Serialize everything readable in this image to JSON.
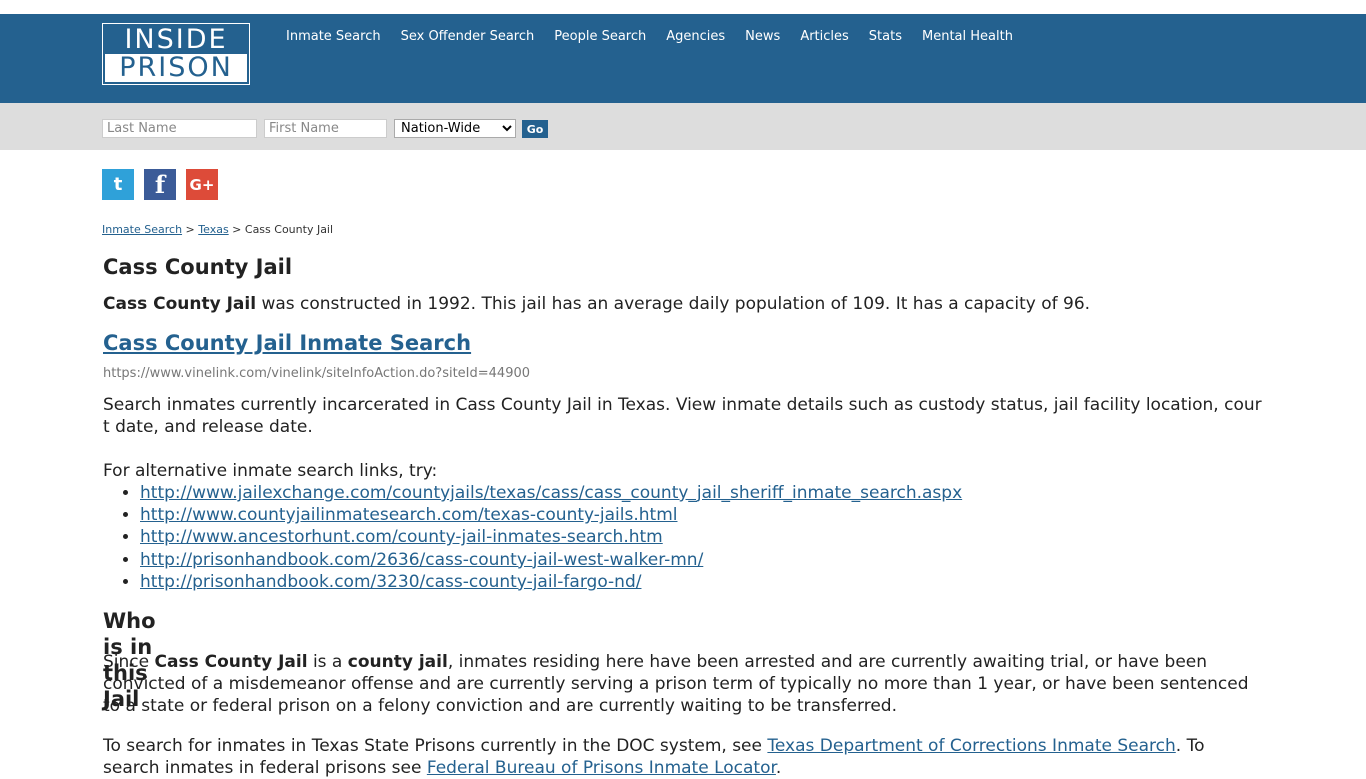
{
  "logo": {
    "line1": "INSIDE",
    "line2": "PRISON"
  },
  "nav": [
    {
      "label": "Inmate Search"
    },
    {
      "label": "Sex Offender Search"
    },
    {
      "label": "People Search"
    },
    {
      "label": "Agencies"
    },
    {
      "label": "News"
    },
    {
      "label": "Articles"
    },
    {
      "label": "Stats"
    },
    {
      "label": "Mental Health"
    }
  ],
  "search": {
    "last_name_placeholder": "Last Name",
    "first_name_placeholder": "First Name",
    "region_selected": "Nation-Wide",
    "go_label": "Go"
  },
  "social": {
    "twitter": "t",
    "facebook": "f",
    "google": "G+"
  },
  "breadcrumb": {
    "home": "Inmate Search",
    "sep": ">",
    "state": "Texas",
    "current": "Cass County Jail"
  },
  "page_title": "Cass County Jail",
  "intro": {
    "bold": "Cass County Jail",
    "rest": " was constructed in 1992. This jail has an average daily population of 109. It has a capacity of 96."
  },
  "search_link": {
    "title": "Cass County Jail Inmate Search",
    "url": "https://www.vinelink.com/vinelink/siteInfoAction.do?siteId=44900"
  },
  "description": "Search inmates currently incarcerated in Cass County Jail in Texas. View inmate details such as custody status, jail facility location, court date, and release date.",
  "alt_heading": "For alternative inmate search links, try:",
  "alt_links": [
    "http://www.jailexchange.com/countyjails/texas/cass/cass_county_jail_sheriff_inmate_search.aspx",
    "http://www.countyjailinmatesearch.com/texas-county-jails.html",
    "http://www.ancestorhunt.com/county-jail-inmates-search.htm",
    "http://prisonhandbook.com/2636/cass-county-jail-west-walker-mn/",
    "http://prisonhandbook.com/3230/cass-county-jail-fargo-nd/"
  ],
  "who_heading": "Who is in this Jail",
  "since": {
    "p1": "Since ",
    "b1": "Cass County Jail",
    "p2": " is a ",
    "b2": "county jail",
    "p3": ", inmates residing here have been arrested and are currently awaiting trial, or have been convicted of a misdemeanor offense and are currently serving a prison term of typically no more than 1 year, or have been sentenced to a state or federal prison on a felony conviction and are currently waiting to be transferred."
  },
  "to_search": {
    "p1": "To search for inmates in Texas State Prisons currently in the DOC system, see ",
    "link1": "Texas Department of Corrections Inmate Search",
    "p2": ". To search inmates in federal prisons see ",
    "link2": "Federal Bureau of Prisons Inmate Locator",
    "p3": "."
  }
}
